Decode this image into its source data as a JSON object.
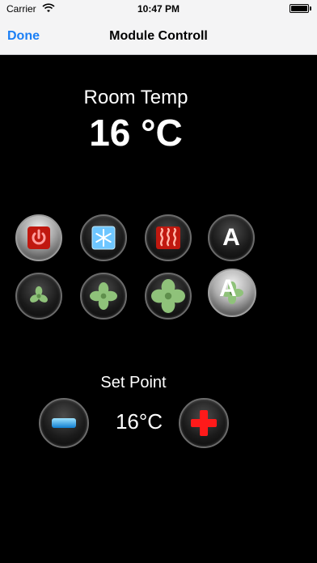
{
  "status_bar": {
    "carrier": "Carrier",
    "time": "10:47 PM"
  },
  "nav": {
    "done_label": "Done",
    "title": "Module Controll"
  },
  "room": {
    "label": "Room Temp",
    "value": "16 °C"
  },
  "mode_buttons": {
    "power_icon": "power-icon",
    "cool_icon": "snowflake-icon",
    "heat_icon": "heater-icon",
    "auto_label": "A"
  },
  "fan_buttons": {
    "low_icon": "fan-low-icon",
    "mid_icon": "fan-mid-icon",
    "high_icon": "fan-high-icon",
    "auto_label": "A"
  },
  "set_point": {
    "label": "Set Point",
    "value": "16°C"
  },
  "colors": {
    "accent": "#1b7ff5",
    "power": "#c0180f",
    "fan": "#8fc27a",
    "cool": "#6ec6ff",
    "plus": "#ff1a1a"
  }
}
